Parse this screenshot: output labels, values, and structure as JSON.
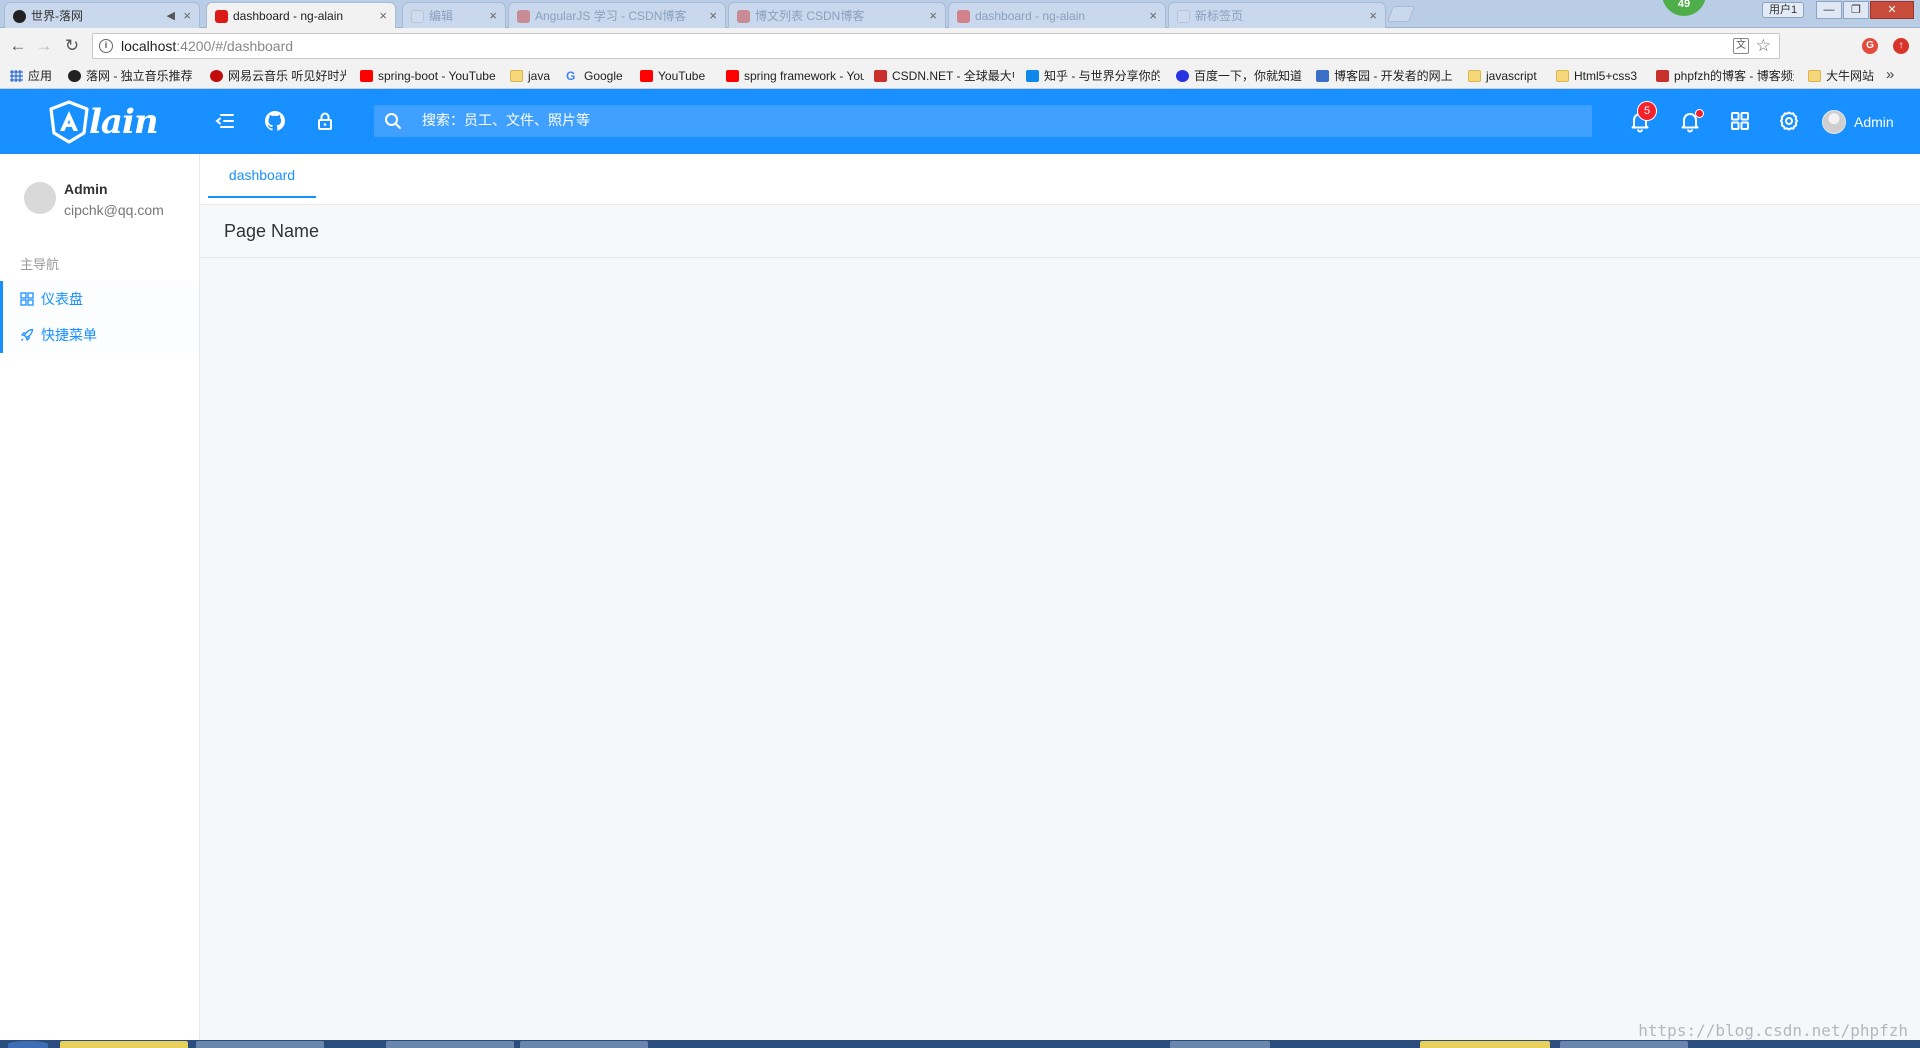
{
  "browser": {
    "tabs": [
      {
        "label": "世界-落网",
        "state": "inactive",
        "icon_color": "#222222"
      },
      {
        "label": "dashboard - ng-alain",
        "state": "active",
        "icon_color": "#dd1b16"
      },
      {
        "label": "编辑",
        "state": "ghost",
        "icon_color": "#c9d8ec"
      },
      {
        "label": "AngularJS 学习 - CSDN博客",
        "state": "ghost",
        "icon_color": "#c9302c"
      },
      {
        "label": "博文列表 CSDN博客",
        "state": "ghost",
        "icon_color": "#c9302c"
      },
      {
        "label": "dashboard - ng-alain",
        "state": "ghost",
        "icon_color": "#dd1b16"
      },
      {
        "label": "新标签页",
        "state": "ghost",
        "icon_color": "#c9d8ec"
      }
    ],
    "tab_close_glyph": "×",
    "counter_badge": "49",
    "user_button": "用户1",
    "window_controls": {
      "minimize": "—",
      "restore": "❐",
      "close": "✕"
    },
    "url_host": "localhost",
    "url_path": ":4200/#/dashboard",
    "bookmarks": [
      {
        "label": "应用",
        "icon": "apps-icon",
        "color": "#3c78d8"
      },
      {
        "label": "落网 - 独立音乐推荐",
        "icon": "luoo-icon",
        "color": "#222222"
      },
      {
        "label": "网易云音乐 听见好时光",
        "icon": "netease-icon",
        "color": "#c20c0c"
      },
      {
        "label": "spring-boot - YouTube",
        "icon": "youtube-icon",
        "color": "#ff0000"
      },
      {
        "label": "java",
        "icon": "folder-icon",
        "color": "#f6d77a"
      },
      {
        "label": "Google",
        "icon": "google-icon",
        "color": "#4285f4"
      },
      {
        "label": "YouTube",
        "icon": "youtube-icon",
        "color": "#ff0000"
      },
      {
        "label": "spring framework - YouTube",
        "icon": "youtube-icon",
        "color": "#ff0000"
      },
      {
        "label": "CSDN.NET - 全球最大中文IT社区",
        "icon": "csdn-icon",
        "color": "#c9302c"
      },
      {
        "label": "知乎 - 与世界分享你的知识",
        "icon": "zhihu-icon",
        "color": "#0f88eb"
      },
      {
        "label": "百度一下，你就知道",
        "icon": "baidu-icon",
        "color": "#2932e1"
      },
      {
        "label": "博客园 - 开发者的网上家园",
        "icon": "cnblogs-icon",
        "color": "#3a6fc7"
      },
      {
        "label": "javascript",
        "icon": "folder-icon",
        "color": "#f6d77a"
      },
      {
        "label": "Html5+css3",
        "icon": "folder-icon",
        "color": "#f6d77a"
      },
      {
        "label": "phpfzh的博客 - 博客频道",
        "icon": "csdn-icon",
        "color": "#c9302c"
      },
      {
        "label": "大牛网站",
        "icon": "folder-icon",
        "color": "#f6d77a"
      }
    ],
    "bookmarks_more": "»"
  },
  "header": {
    "brand": "lain",
    "search_placeholder": "搜索：员工、文件、照片等",
    "notice_count": "5",
    "user_name": "Admin",
    "primary_color": "#1890ff"
  },
  "sidebar": {
    "user_name": "Admin",
    "user_email": "cipchk@qq.com",
    "group_title": "主导航",
    "items": [
      {
        "label": "仪表盘",
        "icon": "dashboard-icon"
      },
      {
        "label": "快捷菜单",
        "icon": "rocket-icon"
      }
    ]
  },
  "main": {
    "tabs": [
      {
        "label": "dashboard"
      }
    ],
    "page_title": "Page Name",
    "watermark": "https://blog.csdn.net/phpfzh"
  }
}
